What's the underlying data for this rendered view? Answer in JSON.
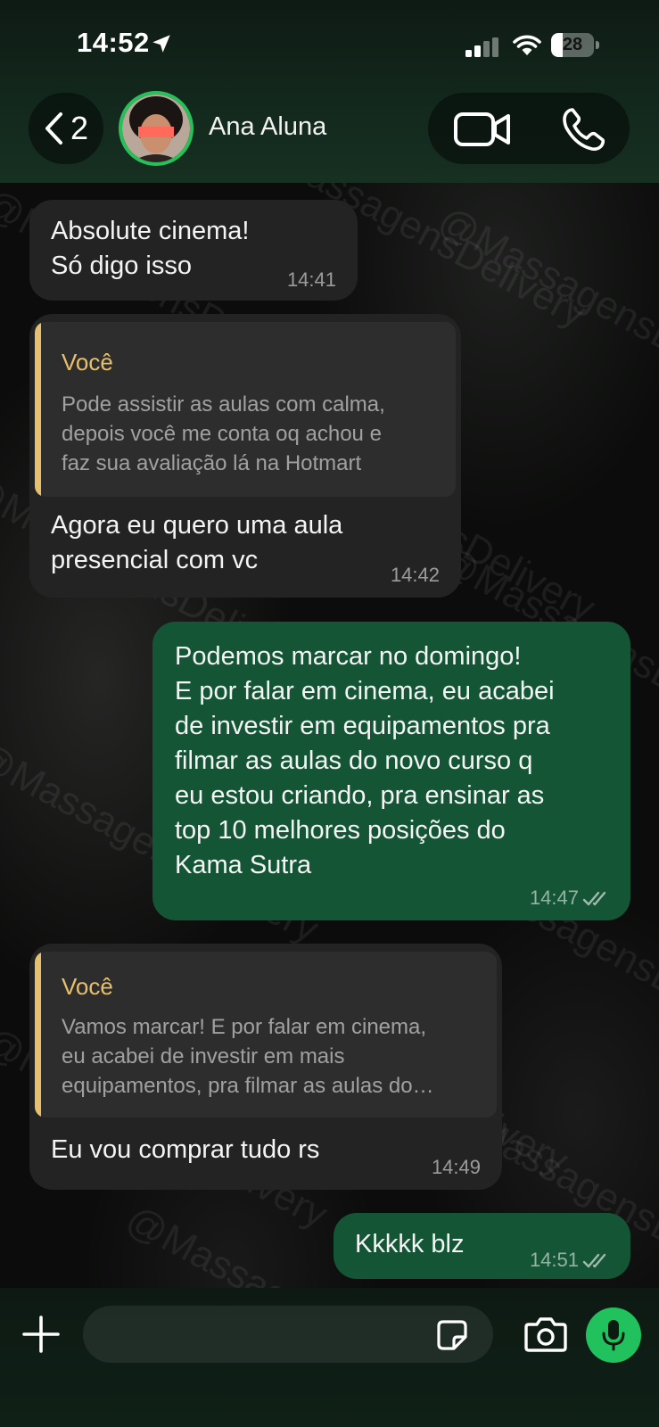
{
  "status_bar": {
    "time": "14:52",
    "battery_level": "28",
    "battery_fraction": 0.28
  },
  "header": {
    "back_count": "2",
    "contact_name": "Ana Aluna"
  },
  "watermark_text": "@MassagensDelivery",
  "messages": [
    {
      "direction": "incoming",
      "text": "Absolute cinema!\nSó digo isso",
      "time": "14:41"
    },
    {
      "direction": "incoming",
      "quote": {
        "author": "Você",
        "text": "Pode assistir as aulas com calma,\ndepois você me conta oq achou e\nfaz sua avaliação lá na Hotmart"
      },
      "text": "Agora eu quero uma aula\npresencial com vc",
      "time": "14:42"
    },
    {
      "direction": "outgoing",
      "text": "Podemos marcar no domingo!\nE por falar em cinema, eu acabei\nde investir em equipamentos pra\nfilmar as aulas do novo curso q\neu estou criando, pra ensinar as\ntop 10 melhores posições do\nKama Sutra",
      "time": "14:47",
      "status": "read"
    },
    {
      "direction": "incoming",
      "quote": {
        "author": "Você",
        "text": "Vamos marcar! E por falar em cinema,\neu acabei de investir em mais\nequipamentos, pra filmar as aulas do…"
      },
      "text": "Eu vou comprar tudo rs",
      "time": "14:49"
    },
    {
      "direction": "outgoing",
      "text": "Kkkkk blz",
      "time": "14:51",
      "status": "read"
    }
  ],
  "colors": {
    "incoming_bubble": "#232323",
    "outgoing_bubble": "#135535",
    "accent_green": "#21c25e",
    "quote_author": "#e6c06c"
  },
  "icons": [
    "location-arrow-icon",
    "signal-icon",
    "wifi-icon",
    "chevron-left-icon",
    "video-call-icon",
    "phone-icon",
    "plus-icon",
    "sticker-icon",
    "camera-icon",
    "mic-icon",
    "double-check-icon"
  ]
}
